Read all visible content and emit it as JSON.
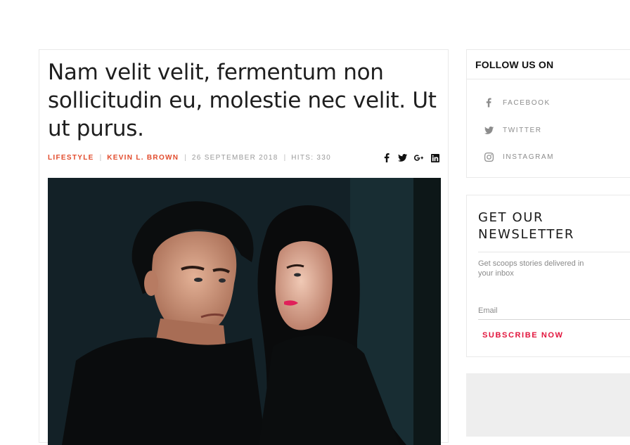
{
  "article": {
    "title": "Nam velit velit, fermentum non sollicitudin eu, molestie nec velit. Ut ut purus.",
    "meta": {
      "category": "LIFESTYLE",
      "author": "KEVIN L. BROWN",
      "date": "26 SEPTEMBER 2018",
      "hits": "HITS: 330",
      "separator": "|"
    },
    "share_icons": [
      "facebook-icon",
      "twitter-icon",
      "google-plus-icon",
      "linkedin-icon"
    ],
    "image": {
      "alt": "Young man and woman in dark clothing"
    }
  },
  "sidebar": {
    "follow": {
      "title": "FOLLOW US ON",
      "items": [
        {
          "label": "FACEBOOK",
          "icon": "facebook-icon"
        },
        {
          "label": "TWITTER",
          "icon": "twitter-icon"
        },
        {
          "label": "INSTAGRAM",
          "icon": "instagram-icon"
        }
      ]
    },
    "newsletter": {
      "title_line1": "GET OUR",
      "title_line2": "NEWSLETTER",
      "description": "Get scoops stories delivered in your inbox",
      "email_placeholder": "Email",
      "button_label": "SUBSCRIBE NOW"
    }
  },
  "colors": {
    "accent_red": "#e24b2c",
    "subscribe_red": "#e2143c",
    "border": "#e9e9e9"
  }
}
